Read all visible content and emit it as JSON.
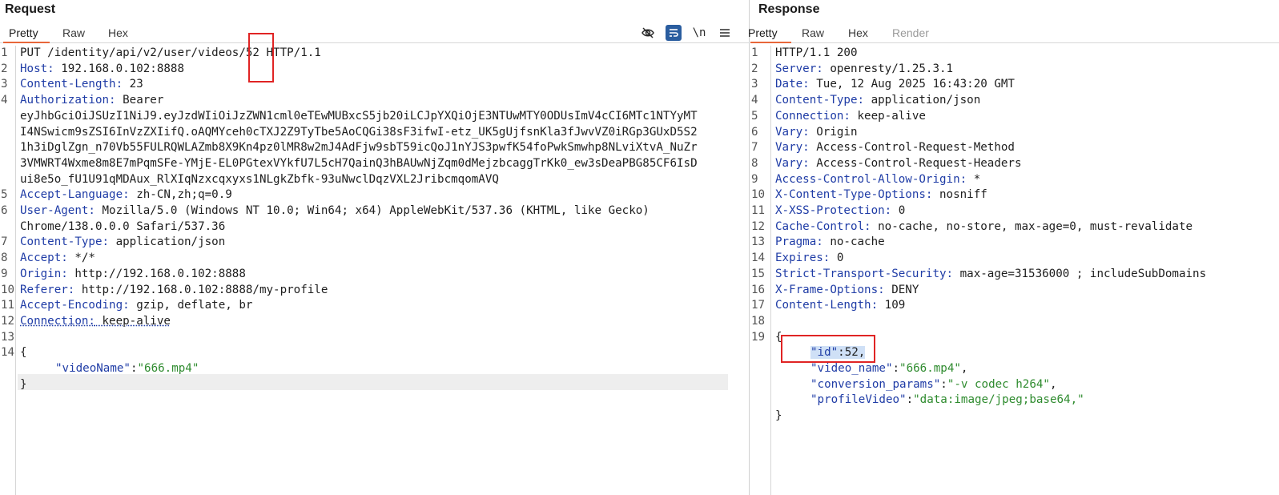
{
  "request": {
    "title": "Request",
    "tabs": [
      "Pretty",
      "Raw",
      "Hex"
    ],
    "tools": {
      "hide_icon": "eye-off-icon",
      "wrap_icon": "wrap-lines-icon",
      "newline_label": "\\n",
      "menu_icon": "menu-icon"
    },
    "line_numbers": [
      "1",
      "2",
      "3",
      "4",
      "",
      "",
      "",
      "",
      "",
      "5",
      "6",
      "",
      "7",
      "8",
      "9",
      "10",
      "11",
      "12",
      "13",
      "14"
    ],
    "lines": {
      "l1": "PUT /identity/api/v2/user/videos/52 HTTP/1.1",
      "l2_key": "Host:",
      "l2_val": " 192.168.0.102:8888",
      "l3_key": "Content-Length:",
      "l3_val": " 23",
      "l4_key": "Authorization:",
      "l4_val": " Bearer",
      "l4_t1": "eyJhbGciOiJSUzI1NiJ9.eyJzdWIiOiJzZWN1cml0eTEwMUBxcS5jb20iLCJpYXQiOjE3NTUwMTY0ODUsImV4cCI6MTc1NTYyMT",
      "l4_t2": "I4NSwicm9sZSI6InVzZXIifQ.oAQMYceh0cTXJ2Z9TyTbe5AoCQGi38sF3ifwI-etz_UK5gUjfsnKla3fJwvVZ0iRGp3GUxD5S2",
      "l4_t3": "1h3iDglZgn_n70Vb55FULRQWLAZmb8X9Kn4pz0lMR8w2mJ4AdFjw9sbT59icQoJ1nYJS3pwfK54foPwkSmwhp8NLviXtvA_NuZr",
      "l4_t4": "3VMWRT4Wxme8m8E7mPqmSFe-YMjE-EL0PGtexVYkfU7L5cH7QainQ3hBAUwNjZqm0dMejzbcaggTrKk0_ew3sDeaPBG85CF6IsD",
      "l4_t5": "ui8e5o_fU1U91qMDAux_RlXIqNzxcqxyxs1NLgkZbfk-93uNwclDqzVXL2JribcmqomAVQ",
      "l5_key": "Accept-Language:",
      "l5_val": " zh-CN,zh;q=0.9",
      "l6_key": "User-Agent:",
      "l6_val": " Mozilla/5.0 (Windows NT 10.0; Win64; x64) AppleWebKit/537.36 (KHTML, like Gecko)",
      "l6_val2": "Chrome/138.0.0.0 Safari/537.36",
      "l7_key": "Content-Type:",
      "l7_val": " application/json",
      "l8_key": "Accept:",
      "l8_val": " */*",
      "l9_key": "Origin:",
      "l9_val": " http://192.168.0.102:8888",
      "l10_key": "Referer:",
      "l10_val": " http://192.168.0.102:8888/my-profile",
      "l11_key": "Accept-Encoding:",
      "l11_val": " gzip, deflate, br",
      "l12_key": "Connection:",
      "l12_val": " keep-alive",
      "l14a": "{",
      "l14b_key": "\"videoName\"",
      "l14b_colon": ":",
      "l14b_val": "\"666.mp4\"",
      "l14c": "}"
    }
  },
  "response": {
    "title": "Response",
    "tabs": [
      "Pretty",
      "Raw",
      "Hex",
      "Render"
    ],
    "line_numbers": [
      "1",
      "2",
      "3",
      "4",
      "5",
      "6",
      "7",
      "8",
      "9",
      "10",
      "11",
      "12",
      "13",
      "14",
      "15",
      "16",
      "17",
      "18",
      "19"
    ],
    "lines": {
      "r1": "HTTP/1.1 200",
      "r2_key": "Server:",
      "r2_val": " openresty/1.25.3.1",
      "r3_key": "Date:",
      "r3_val": " Tue, 12 Aug 2025 16:43:20 GMT",
      "r4_key": "Content-Type:",
      "r4_val": " application/json",
      "r5_key": "Connection:",
      "r5_val": " keep-alive",
      "r6_key": "Vary:",
      "r6_val": " Origin",
      "r7_key": "Vary:",
      "r7_val": " Access-Control-Request-Method",
      "r8_key": "Vary:",
      "r8_val": " Access-Control-Request-Headers",
      "r9_key": "Access-Control-Allow-Origin:",
      "r9_val": " *",
      "r10_key": "X-Content-Type-Options:",
      "r10_val": " nosniff",
      "r11_key": "X-XSS-Protection:",
      "r11_val": " 0",
      "r12_key": "Cache-Control:",
      "r12_val": " no-cache, no-store, max-age=0, must-revalidate",
      "r13_key": "Pragma:",
      "r13_val": " no-cache",
      "r14_key": "Expires:",
      "r14_val": " 0",
      "r15_key": "Strict-Transport-Security:",
      "r15_val": " max-age=31536000 ; includeSubDomains",
      "r16_key": "X-Frame-Options:",
      "r16_val": " DENY",
      "r17_key": "Content-Length:",
      "r17_val": " 109",
      "r19a": "{",
      "j1_key": "\"id\"",
      "j1_rest": ":52,",
      "j2_key": "\"video_name\"",
      "j2_colon": ":",
      "j2_val": "\"666.mp4\"",
      "j2_comma": ",",
      "j3_key": "\"conversion_params\"",
      "j3_colon": ":",
      "j3_val": "\"-v codec h264\"",
      "j3_comma": ",",
      "j4_key": "\"profileVideo\"",
      "j4_colon": ":",
      "j4_val": "\"data:image/jpeg;base64,\"",
      "r19e": "}"
    }
  },
  "colors": {
    "header_key": "#1f3ca6",
    "string": "#2e8b2e",
    "tab_active_underline": "#e8673a",
    "highlight_box": "#e02424",
    "selection": "#cfe0f6"
  }
}
